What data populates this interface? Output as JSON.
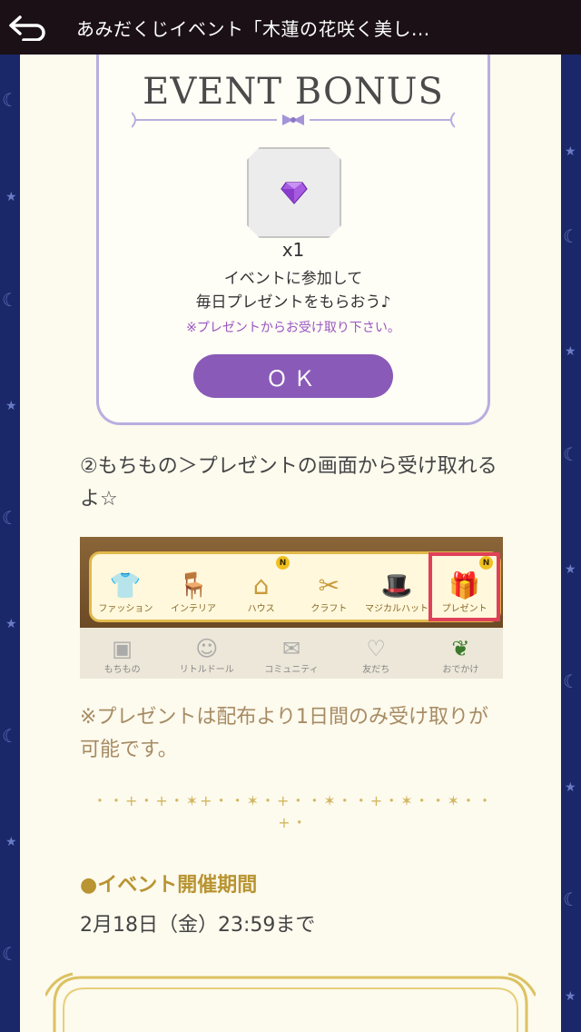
{
  "header": {
    "title": "あみだくじイベント「木蓮の花咲く美し...",
    "back_icon": "back-arrow-icon"
  },
  "bonus_card": {
    "title": "EVENT BONUS",
    "item_icon": "purple-gem-icon",
    "quantity": "x1",
    "message_line1": "イベントに参加して",
    "message_line2": "毎日プレゼントをもらおう♪",
    "note": "※プレゼントからお受け取り下さい。",
    "ok_label": "ＯＫ"
  },
  "step_text": "②もちもの＞プレゼントの画面から受け取れるよ☆",
  "game_menu": {
    "top_items": [
      {
        "label": "ファッション",
        "icon": "shirt-icon"
      },
      {
        "label": "インテリア",
        "icon": "chair-icon"
      },
      {
        "label": "ハウス",
        "icon": "house-icon"
      },
      {
        "label": "クラフト",
        "icon": "craft-icon"
      },
      {
        "label": "マジカルハット",
        "icon": "hat-icon"
      },
      {
        "label": "プレゼント",
        "icon": "gift-icon"
      }
    ],
    "bottom_items": [
      {
        "label": "もちもの",
        "icon": "wardrobe-icon"
      },
      {
        "label": "リトルドール",
        "icon": "doll-icon"
      },
      {
        "label": "コミュニティ",
        "icon": "chat-icon"
      },
      {
        "label": "友だち",
        "icon": "friends-icon"
      },
      {
        "label": "おでかけ",
        "icon": "leaf-icon"
      }
    ],
    "badge_letter": "N",
    "highlight_color": "#e0405a"
  },
  "note2": "※プレゼントは配布より1日間のみ受け取りが可能です。",
  "sparkle_text": "・・+・+・✶+・・✶・+・・✶・・+・✶・・✶・・+・",
  "period": {
    "heading": "●イベント開催期間",
    "value": "2月18日（金）23:59まで"
  },
  "colors": {
    "accent_purple": "#8a5ab8",
    "gold": "#b89432",
    "background": "#fdfaee",
    "side_navy": "#1a2768"
  }
}
